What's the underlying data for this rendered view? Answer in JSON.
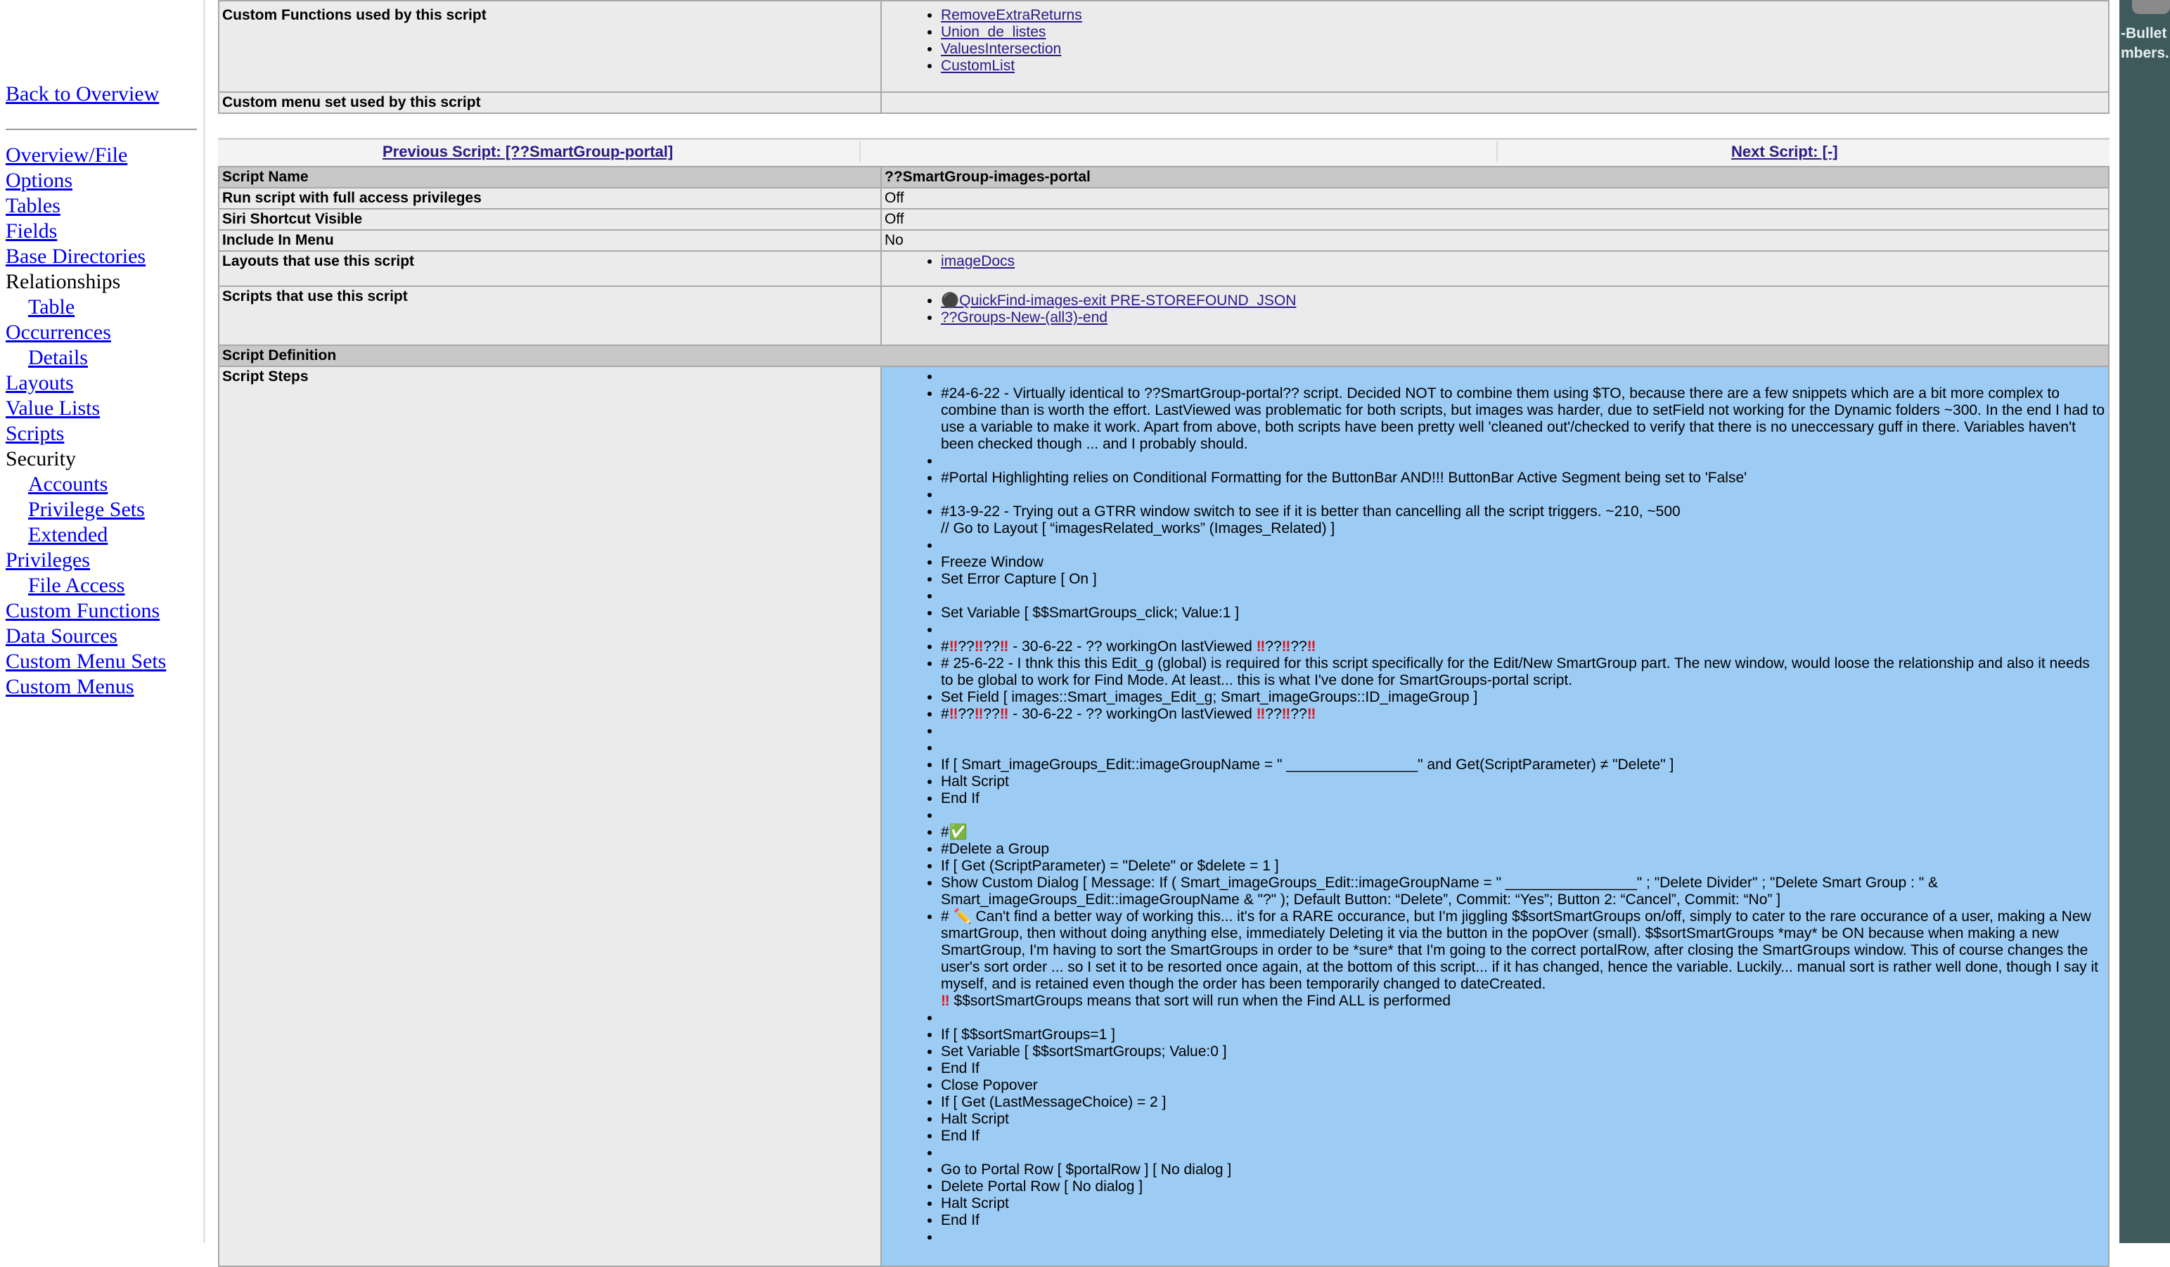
{
  "nav": {
    "back": "Back to Overview",
    "items": [
      {
        "label": "Overview/File",
        "link": true,
        "indent": false
      },
      {
        "label": "Options",
        "link": true,
        "indent": false
      },
      {
        "label": "Tables",
        "link": true,
        "indent": false
      },
      {
        "label": "Fields",
        "link": true,
        "indent": false
      },
      {
        "label": "Base Directories",
        "link": true,
        "indent": false
      },
      {
        "label": "Relationships",
        "link": false,
        "indent": false
      },
      {
        "label": "Table",
        "link": true,
        "indent": true
      },
      {
        "label": "Occurrences",
        "link": true,
        "indent": false
      },
      {
        "label": "Details",
        "link": true,
        "indent": true
      },
      {
        "label": "Layouts",
        "link": true,
        "indent": false
      },
      {
        "label": "Value Lists",
        "link": true,
        "indent": false
      },
      {
        "label": "Scripts",
        "link": true,
        "indent": false
      },
      {
        "label": "Security",
        "link": false,
        "indent": false
      },
      {
        "label": "Accounts",
        "link": true,
        "indent": true
      },
      {
        "label": "Privilege Sets",
        "link": true,
        "indent": true
      },
      {
        "label": "Extended",
        "link": true,
        "indent": true
      },
      {
        "label": "Privileges",
        "link": true,
        "indent": false
      },
      {
        "label": "File Access",
        "link": true,
        "indent": true
      },
      {
        "label": "Custom Functions",
        "link": true,
        "indent": false
      },
      {
        "label": "Data Sources",
        "link": true,
        "indent": false
      },
      {
        "label": "Custom Menu Sets",
        "link": true,
        "indent": false
      },
      {
        "label": "Custom Menus",
        "link": true,
        "indent": false
      }
    ]
  },
  "prev_table": {
    "custom_functions_label": "Custom Functions used by this script",
    "custom_functions": [
      "RemoveExtraReturns",
      "Union_de_listes",
      "ValuesIntersection",
      "CustomList"
    ],
    "custom_menu_label": "Custom menu set used by this script",
    "custom_menu_value": ""
  },
  "navigation": {
    "previous": "Previous Script: [??SmartGroup-portal]",
    "next": "Next Script: [-]"
  },
  "script": {
    "name_label": "Script Name",
    "name": "??SmartGroup-images-portal",
    "full_access_label": "Run script with full access privileges",
    "full_access": "Off",
    "siri_label": "Siri Shortcut Visible",
    "siri": "Off",
    "include_menu_label": "Include In Menu",
    "include_menu": "No",
    "layouts_label": "Layouts that use this script",
    "layouts": [
      "imageDocs"
    ],
    "scripts_label": "Scripts that use this script",
    "scripts": [
      "⚫QuickFind-images-exit PRE-STOREFOUND_JSON",
      "??Groups-New-(all3)-end"
    ],
    "definition_label": "Script Definition",
    "steps_label": "Script Steps",
    "steps": [
      "",
      "#24-6-22 - Virtually identical to ??SmartGroup-portal?? script. Decided NOT to combine them using $TO, because there are a few snippets which are a bit more complex to combine than is worth the effort. LastViewed was problematic for both scripts, but images was harder, due to setField not working for the Dynamic folders ~300. In the end I had to use a variable to make it work. Apart from above, both scripts have been pretty well 'cleaned out'/checked to verify that there is no uneccessary guff in there. Variables haven't been checked though ... and I probably should.",
      "",
      "#Portal Highlighting relies on Conditional Formatting for the ButtonBar AND!!! ButtonBar Active Segment being set to 'False'",
      "",
      "#13-9-22 - Trying out a GTRR window switch to see if it is better than cancelling all the script triggers. ~210, ~500\n// Go to Layout [ “imagesRelated_works” (Images_Related) ]",
      "",
      "Freeze Window",
      "Set Error Capture [ On ]",
      "",
      "Set Variable [ $$SmartGroups_click; Value:1 ]",
      "",
      "#‼??‼??‼ - 30-6-22 - ?? workingOn lastViewed ‼??‼??‼",
      "# 25-6-22 - I thnk this this Edit_g (global) is required for this script specifically for the Edit/New SmartGroup part. The new window, would loose the relationship and also it needs to be global to work for Find Mode. At least... this is what I've done for SmartGroups-portal script.",
      "Set Field [ images::Smart_images_Edit_g; Smart_imageGroups::ID_imageGroup ]",
      "#‼??‼??‼ - 30-6-22 - ?? workingOn lastViewed ‼??‼??‼",
      "",
      "",
      "If [ Smart_imageGroups_Edit::imageGroupName = \" ________________\" and Get(ScriptParameter) ≠ \"Delete\" ]",
      "Halt Script",
      "End If",
      "",
      "#✅",
      "#Delete a Group",
      "If [ Get (ScriptParameter) = \"Delete\" or $delete = 1 ]",
      "Show Custom Dialog [ Message: If ( Smart_imageGroups_Edit::imageGroupName = \" ________________\" ; \"Delete Divider\" ; \"Delete Smart Group : \" & Smart_imageGroups_Edit::imageGroupName & \"?\" ); Default Button: “Delete”, Commit: “Yes”; Button 2: “Cancel”, Commit: “No” ]",
      "# ✏️ Can't find a better way of working this... it's for a RARE occurance, but I'm jiggling $$sortSmartGroups on/off, simply to cater to the rare occurance of a user, making a New smartGroup, then without doing anything else, immediately Deleting it via the button in the popOver (small). $$sortSmartGroups *may* be ON because when making a new SmartGroup, I'm having to sort the SmartGroups in order to be *sure* that I'm going to the correct portalRow, after closing the SmartGroups window. This of course changes the user's sort order ... so I set it to be resorted once again, at the bottom of this script... if it has changed, hence the variable. Luckily... manual sort is rather well done, though I say it myself, and is retained even though the order has been temporarily changed to dateCreated.\n‼ $$sortSmartGroups means that sort will run when the Find ALL is performed",
      "",
      "If [ $$sortSmartGroups=1 ]",
      "Set Variable [ $$sortSmartGroups; Value:0 ]",
      "End If",
      "Close Popover",
      "If [ Get (LastMessageChoice) = 2 ]",
      "Halt Script",
      "End If",
      "",
      "Go to Portal Row [ $portalRow ] [ No dialog ]",
      "Delete Portal Row [ No dialog ]",
      "Halt Script",
      "End If",
      ""
    ]
  },
  "right_strip": {
    "text_line1": "-Bullet",
    "text_line2": "mbers."
  }
}
